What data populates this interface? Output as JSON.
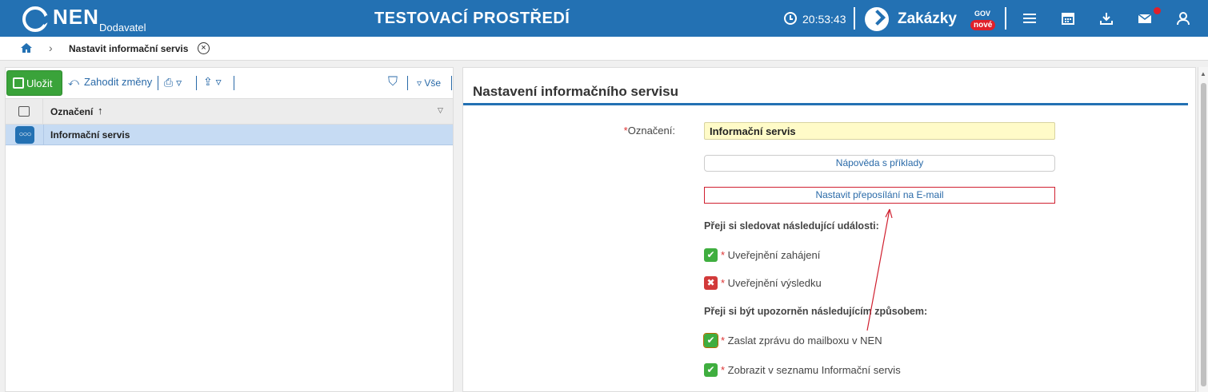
{
  "topbar": {
    "logo": "NEN",
    "logo_sub": "Dodavatel",
    "environment_title": "TESTOVACÍ PROSTŘEDÍ",
    "clock_time": "20:53:43",
    "zakazky_label": "Zakázky",
    "zakazky_gov": "GOV",
    "zakazky_new_badge": "nové",
    "icons": [
      "menu-icon",
      "calendar-icon",
      "download-icon",
      "mail-icon",
      "user-icon"
    ],
    "brand_color": "#2371b3"
  },
  "breadcrumb": {
    "separator": "›",
    "current": "Nastavit informační servis"
  },
  "toolbar": {
    "save_label": "Uložit",
    "discard_label": "Zahodit změny",
    "filter_all_label": "Vše"
  },
  "grid": {
    "column_header": "Označení",
    "sort_indicator": "↑",
    "rows": [
      {
        "label": "Informační servis",
        "selected": true
      }
    ]
  },
  "form": {
    "title": "Nastavení informačního servisu",
    "label_field": "Označení:",
    "label_value": "Informační servis",
    "help_button": "Nápověda s příklady",
    "email_forward_button": "Nastavit přeposílání na E-mail",
    "events_heading": "Přeji si sledovat následující události:",
    "events": [
      {
        "label": "Uveřejnění zahájení",
        "checked": true
      },
      {
        "label": "Uveřejnění výsledku",
        "checked": false
      }
    ],
    "notify_heading": "Přeji si být upozorněn následujícím způsobem:",
    "notify_options": [
      {
        "label": "Zaslat zprávu do mailboxu v NEN",
        "checked": true
      },
      {
        "label": "Zobrazit v seznamu Informační servis",
        "checked": true
      }
    ]
  }
}
